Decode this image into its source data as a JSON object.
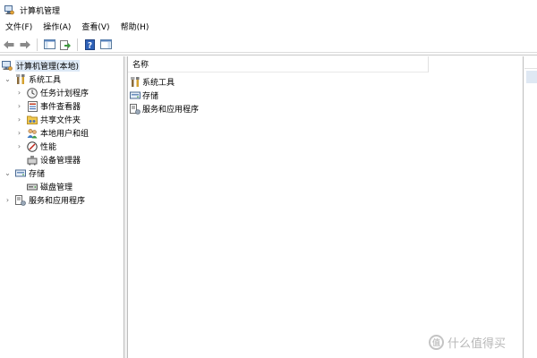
{
  "window": {
    "title": "计算机管理"
  },
  "menu": [
    "文件(F)",
    "操作(A)",
    "查看(V)",
    "帮助(H)"
  ],
  "toolbar": {
    "buttons": [
      "back-icon",
      "forward-icon",
      "show-hide-tree-icon",
      "export-list-icon",
      "help-icon",
      "show-action-pane-icon"
    ]
  },
  "tree": {
    "root": "计算机管理(本地)",
    "items": [
      {
        "label": "系统工具",
        "icon": "tools-icon"
      },
      {
        "label": "任务计划程序",
        "icon": "clock-icon"
      },
      {
        "label": "事件查看器",
        "icon": "event-log-icon"
      },
      {
        "label": "共享文件夹",
        "icon": "shared-folder-icon"
      },
      {
        "label": "本地用户和组",
        "icon": "users-icon"
      },
      {
        "label": "性能",
        "icon": "performance-icon"
      },
      {
        "label": "设备管理器",
        "icon": "device-icon"
      },
      {
        "label": "存储",
        "icon": "storage-icon"
      },
      {
        "label": "磁盘管理",
        "icon": "disk-icon"
      },
      {
        "label": "服务和应用程序",
        "icon": "services-icon"
      }
    ]
  },
  "list": {
    "header": "名称",
    "rows": [
      "系统工具",
      "存储",
      "服务和应用程序"
    ]
  },
  "watermark": {
    "text": "什么值得买",
    "icon_text": "值"
  },
  "colors": {
    "selection": "#dde9f6",
    "border": "#bdbdbd"
  }
}
